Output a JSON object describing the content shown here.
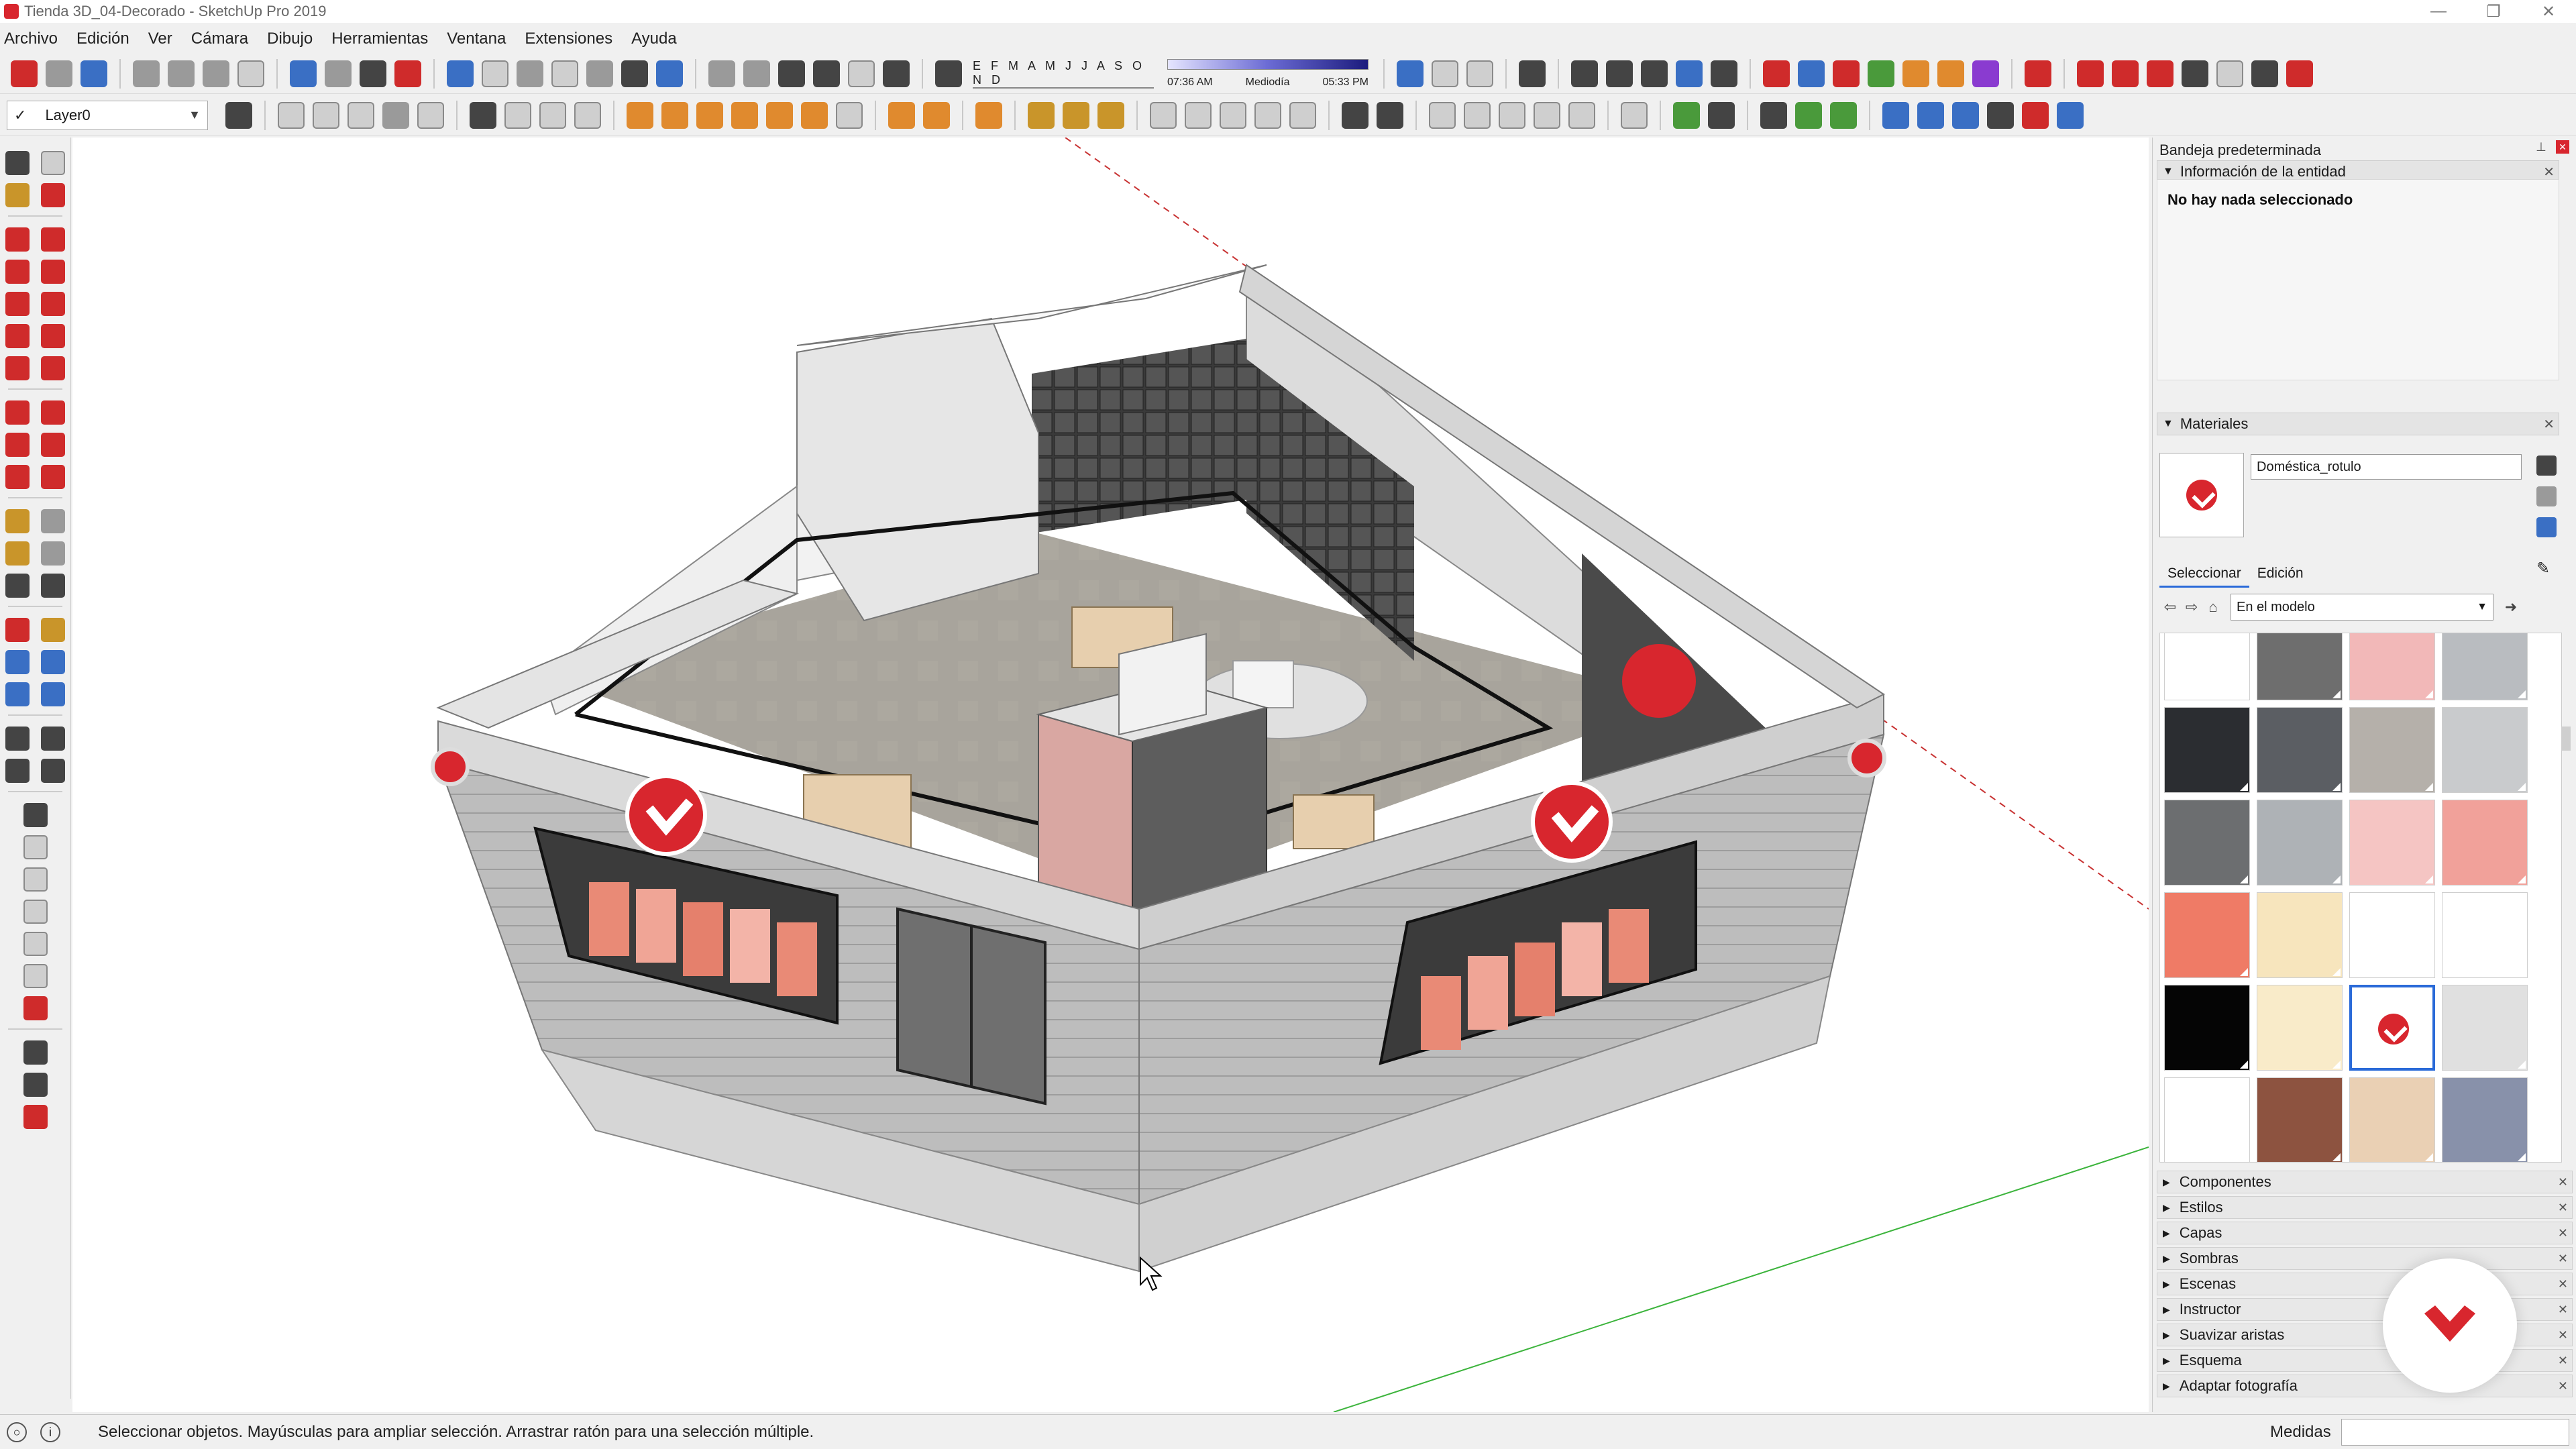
{
  "window": {
    "title": "Tienda 3D_04-Decorado - SketchUp Pro 2019"
  },
  "menu": [
    "Archivo",
    "Edición",
    "Ver",
    "Cámara",
    "Dibujo",
    "Herramientas",
    "Ventana",
    "Extensiones",
    "Ayuda"
  ],
  "toolbar": {
    "layer_name": "Layer0",
    "shadow_months": "E F M A M J J A S O N D",
    "time_start": "07:36 AM",
    "time_mid": "Mediodía",
    "time_end": "05:33 PM"
  },
  "tray": {
    "title": "Bandeja predeterminada",
    "entity_info": {
      "header": "Información de la entidad",
      "message": "No hay nada seleccionado"
    },
    "materials": {
      "header": "Materiales",
      "material_name": "Doméstica_rotulo",
      "tabs": [
        "Seleccionar",
        "Edición"
      ],
      "active_tab": "Seleccionar",
      "collection": "En el modelo",
      "swatches": [
        {
          "color": "#ffffff"
        },
        {
          "color": "#6e6e6e"
        },
        {
          "color": "#f2b8b8"
        },
        {
          "color": "#b9bcc0"
        },
        {
          "color": "#2b2d31"
        },
        {
          "color": "#5b5e63"
        },
        {
          "color": "#b5b0aa"
        },
        {
          "color": "#c9cbcd"
        },
        {
          "color": "#6c6e70"
        },
        {
          "color": "#aeb2b6"
        },
        {
          "color": "#f5c5c3"
        },
        {
          "color": "#f1a19a"
        },
        {
          "color": "#ef7b66"
        },
        {
          "color": "#f7e5bd"
        },
        {
          "color": "#ffffff"
        },
        {
          "color": "#ffffff"
        },
        {
          "color": "#050505"
        },
        {
          "color": "#f9ebc9"
        },
        {
          "color": "selected-logo"
        },
        {
          "color": "#e0e0e0"
        },
        {
          "color": "#ffffff"
        },
        {
          "color": "#8d5340"
        },
        {
          "color": "#ead0b4"
        },
        {
          "color": "#8891aa"
        },
        {
          "color": "#7d87a3"
        },
        {
          "color": "#c0bcb6"
        },
        {
          "color": "#c9c5bf"
        },
        {
          "color": "#0b0b0b"
        }
      ]
    },
    "collapsed_panels": [
      "Componentes",
      "Estilos",
      "Capas",
      "Sombras",
      "Escenas",
      "Instructor",
      "Suavizar aristas",
      "Esquema",
      "Adaptar fotografía"
    ]
  },
  "status": {
    "message": "Seleccionar objetos. Mayúsculas para ampliar selección. Arrastrar ratón para una selección múltiple.",
    "measure_label": "Medidas",
    "measure_value": ""
  },
  "colors": {
    "brand_red": "#d8262e",
    "selection_blue": "#2a6ad8",
    "axis_red": "#c83232",
    "axis_green": "#3cb43c"
  }
}
